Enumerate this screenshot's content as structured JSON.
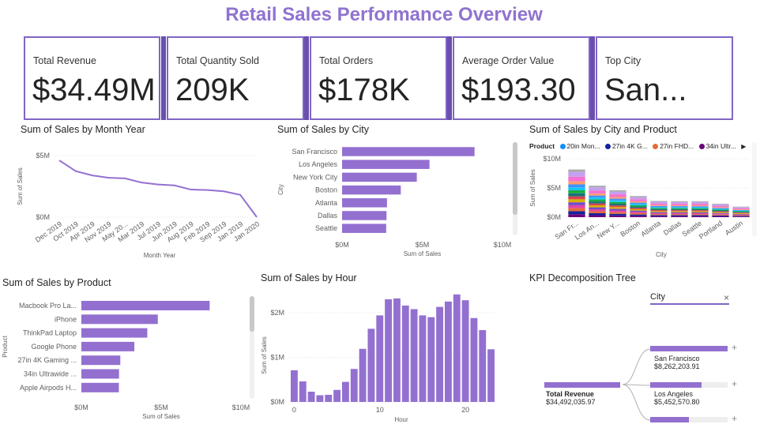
{
  "title": "Retail Sales Performance Overview",
  "colors": {
    "accent": "#8F73CF",
    "bar": "#9370D0",
    "border": "#8066C4"
  },
  "kpis": [
    {
      "label": "Total Revenue",
      "value": "$34.49M"
    },
    {
      "label": "Total Quantity Sold",
      "value": "209K"
    },
    {
      "label": "Total Orders",
      "value": "$178K"
    },
    {
      "label": "Average Order Value",
      "value": "$193.30"
    },
    {
      "label": "Top City",
      "value": "San..."
    }
  ],
  "visuals": {
    "month": {
      "title": "Sum of Sales by Month Year",
      "xlabel": "Month Year",
      "ylabel": "Sum of Sales"
    },
    "city": {
      "title": "Sum of Sales by City",
      "xlabel": "Sum of Sales",
      "ylabel": "City"
    },
    "city_product": {
      "title": "Sum of Sales by City and Product",
      "xlabel": "City",
      "ylabel": "Sum of Sales",
      "legend_title": "Product"
    },
    "product": {
      "title": "Sum of Sales by Product",
      "xlabel": "Sum of Sales",
      "ylabel": "Product"
    },
    "hour": {
      "title": "Sum of Sales by Hour",
      "xlabel": "Hour",
      "ylabel": "Sum of Sales"
    },
    "tree": {
      "title": "KPI Decomposition Tree",
      "field": "City",
      "close_icon": "close-icon",
      "root": {
        "label": "Total Revenue",
        "value": "$34,492,035.97"
      },
      "children": [
        {
          "label": "San Francisco",
          "value": "$8,262,203.91",
          "share": 0.24
        },
        {
          "label": "Los Angeles",
          "value": "$5,452,570.80",
          "share": 0.158
        },
        {
          "share": 0.12
        }
      ]
    }
  },
  "chart_data": [
    {
      "type": "line",
      "title": "Sum of Sales by Month Year",
      "xlabel": "Month Year",
      "ylabel": "Sum of Sales",
      "x": [
        "Dec 2019",
        "Oct 2019",
        "Apr 2019",
        "Nov 2019",
        "May 20...",
        "Mar 2019",
        "Jul 2019",
        "Jun 2019",
        "Aug 2019",
        "Feb 2019",
        "Sep 2019",
        "Jan 2019",
        "Jan 2020"
      ],
      "values": [
        4.61,
        3.74,
        3.39,
        3.2,
        3.15,
        2.81,
        2.65,
        2.58,
        2.24,
        2.2,
        2.1,
        1.81,
        0.01
      ],
      "yticks": [
        "$0M",
        "$5M"
      ],
      "ylim": [
        0,
        5
      ]
    },
    {
      "type": "bar",
      "title": "Sum of Sales by City",
      "categories": [
        "San Francisco",
        "Los Angeles",
        "New York City",
        "Boston",
        "Atlanta",
        "Dallas",
        "Seattle"
      ],
      "values": [
        8.26,
        5.45,
        4.66,
        3.66,
        2.8,
        2.77,
        2.75
      ],
      "xticks": [
        "$0M",
        "$5M",
        "$10M"
      ],
      "xlim": [
        0,
        10
      ]
    },
    {
      "type": "bar",
      "title": "Sum of Sales by City and Product",
      "categories": [
        "San Fr...",
        "Los An...",
        "New Y...",
        "Boston",
        "Atlanta",
        "Dallas",
        "Seattle",
        "Portland",
        "Austin"
      ],
      "totals": [
        8.26,
        5.45,
        4.66,
        3.66,
        2.8,
        2.77,
        2.75,
        2.32,
        1.82
      ],
      "yticks": [
        "$0M",
        "$5M",
        "$10M"
      ],
      "ylim": [
        0,
        10
      ],
      "legend": [
        "20in Mon...",
        "27in 4K G...",
        "27in FHD...",
        "34in Ultr..."
      ],
      "legend_colors": [
        "#118DFF",
        "#12239E",
        "#E66C37",
        "#6B007B"
      ],
      "stack_colors": [
        "#6B007B",
        "#12239E",
        "#E66C37",
        "#E044A7",
        "#744EC2",
        "#D9B300",
        "#D64550",
        "#197278",
        "#1AAB40",
        "#15C6F4",
        "#4092FF",
        "#FF9E6B",
        "#F472D0",
        "#C4A0F0",
        "#AAAAAA"
      ]
    },
    {
      "type": "bar",
      "title": "Sum of Sales by Product",
      "categories": [
        "Macbook Pro La...",
        "iPhone",
        "ThinkPad Laptop",
        "Google Phone",
        "27in 4K Gaming ...",
        "34in Ultrawide ...",
        "Apple Airpods H..."
      ],
      "values": [
        8.04,
        4.79,
        4.13,
        3.32,
        2.44,
        2.36,
        2.35
      ],
      "xticks": [
        "$0M",
        "$5M",
        "$10M"
      ],
      "xlim": [
        0,
        10
      ]
    },
    {
      "type": "bar",
      "title": "Sum of Sales by Hour",
      "x": [
        0,
        1,
        2,
        3,
        4,
        5,
        6,
        7,
        8,
        9,
        10,
        11,
        12,
        13,
        14,
        15,
        16,
        17,
        18,
        19,
        20,
        21,
        22,
        23
      ],
      "values": [
        0.71,
        0.46,
        0.23,
        0.15,
        0.16,
        0.27,
        0.45,
        0.74,
        1.19,
        1.64,
        1.94,
        2.3,
        2.32,
        2.16,
        2.08,
        1.94,
        1.9,
        2.13,
        2.25,
        2.41,
        2.28,
        1.88,
        1.61,
        1.18
      ],
      "yticks": [
        "$0M",
        "$1M",
        "$2M"
      ],
      "xticks": [
        "0",
        "10",
        "20"
      ],
      "ylim": [
        0,
        2.4
      ]
    }
  ]
}
